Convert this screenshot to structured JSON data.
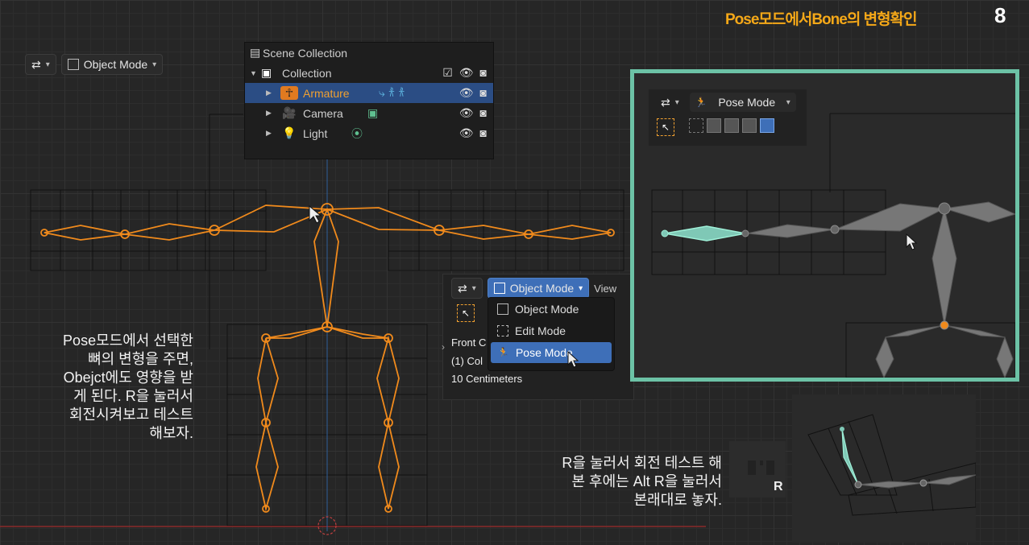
{
  "slide": {
    "title": "Pose모드에서Bone의 변형확인",
    "page_number": "8"
  },
  "header_left": {
    "mode_label": "Object Mode"
  },
  "outliner": {
    "scene_collection": "Scene Collection",
    "collection": "Collection",
    "items": [
      {
        "label": "Armature"
      },
      {
        "label": "Camera"
      },
      {
        "label": "Light"
      }
    ]
  },
  "mode_popup": {
    "mode_label": "Object Mode",
    "view_label": "View",
    "items": [
      "Object Mode",
      "Edit Mode",
      "Pose Mode"
    ],
    "info_lines": [
      "Front C",
      "(1) Col",
      "10 Centimeters"
    ]
  },
  "right_panel": {
    "mode_label": "Pose Mode"
  },
  "captions": {
    "left": [
      "Pose모드에서 선택한",
      "뼈의 변형을 주면,",
      "Obejct에도 영향을 받",
      "게 된다.  R을 눌러서",
      "회전시켜보고 테스트",
      "해보자."
    ],
    "bottom": [
      "R을 눌러서 회전 테스트 해",
      "본 후에는 Alt R을 눌러서",
      "본래대로 놓자."
    ]
  },
  "key_hint": "R",
  "colors": {
    "accent": "#f5a818",
    "bone": "#f08a1c",
    "highlight_border": "#6cc2a6",
    "selection": "#3e6fb8"
  }
}
